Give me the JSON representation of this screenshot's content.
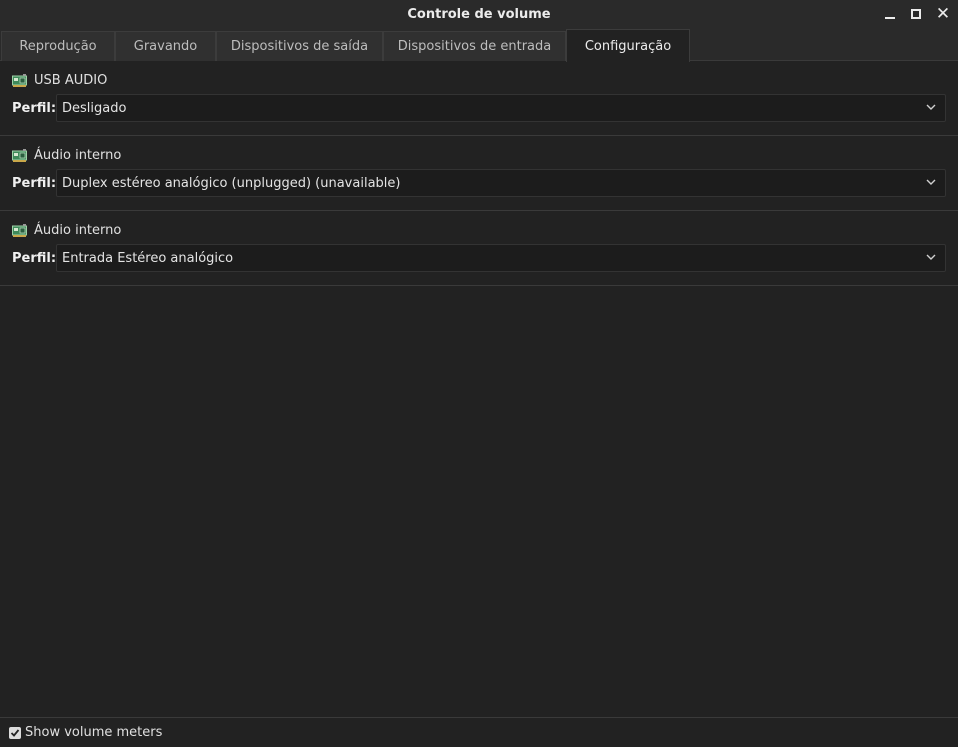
{
  "window": {
    "title": "Controle de volume"
  },
  "tabs": [
    {
      "label": "Reprodução",
      "active": false
    },
    {
      "label": "Gravando",
      "active": false
    },
    {
      "label": "Dispositivos de saída",
      "active": false
    },
    {
      "label": "Dispositivos de entrada",
      "active": false
    },
    {
      "label": "Configuração",
      "active": true
    }
  ],
  "cards": [
    {
      "name": "USB  AUDIO",
      "profile_label": "Perfil:",
      "profile_value": "Desligado",
      "icon": "sound-card-icon"
    },
    {
      "name": "Áudio interno",
      "profile_label": "Perfil:",
      "profile_value": "Duplex estéreo analógico (unplugged) (unavailable)",
      "icon": "sound-card-icon"
    },
    {
      "name": "Áudio interno",
      "profile_label": "Perfil:",
      "profile_value": "Entrada Estéreo analógico",
      "icon": "sound-card-icon"
    }
  ],
  "footer": {
    "show_meters_label": "Show volume meters",
    "show_meters_checked": true
  },
  "colors": {
    "background": "#222222",
    "titlebar": "#2a2a2a",
    "text": "#dcdcdc",
    "combo_background": "#1c1c1c"
  }
}
